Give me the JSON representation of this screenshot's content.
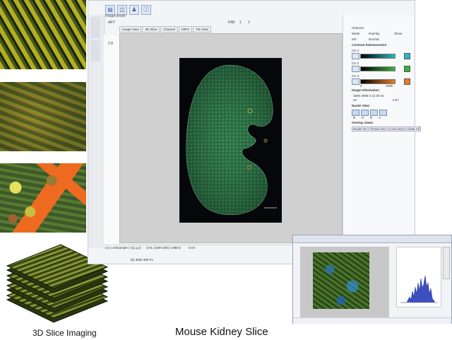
{
  "captions": {
    "left": "3D Slice Imaging",
    "right": "Mouse Kidney Slice"
  },
  "app": {
    "window_title": "ImageViewer",
    "tabs": [
      "AKY",
      "FAB",
      "1",
      "2"
    ],
    "viewer_tabs": [
      "Image View",
      "3D Slice",
      "Channel",
      "MIPS",
      "Tile View"
    ],
    "left_label": "CH",
    "status": {
      "left": "Z:3  |  ctrl/sample | /c[x,y,z]",
      "coords": "CH1 (1600-300) CH3",
      "mid": "CH2",
      "right": "CH3",
      "sub": "(b) 3000 300 Px"
    },
    "right_panel": {
      "section_display": "Channel",
      "mode_label": "Mode",
      "mode_value": "Overlay",
      "sel_label": "Sel",
      "sel_value": "Normal",
      "show_label": "Show",
      "contrast_title": "Contrast Enhancement",
      "ch1": "CH 1",
      "ch2": "CH 2",
      "ch3": "CH 3",
      "val_low": "0",
      "val_high": "4095",
      "range_title": "Image Information",
      "info_line1": "1600  4095  0  12  00  01",
      "info_line2": "x0",
      "info_line3": "0.07",
      "palette_title": "Nuclei View",
      "palette_values": [
        "B",
        "G",
        "R",
        "A"
      ],
      "overlay_title": "Overlay views",
      "overlay_buttons": [
        "Nuclei On",
        "Tissue On",
        "Cross Sect",
        "Clear All"
      ]
    }
  },
  "colors": {
    "ch1": "#2bb8c8",
    "ch2": "#3ab33a",
    "ch3": "#f07a20",
    "tissue": "#2c7a44"
  }
}
